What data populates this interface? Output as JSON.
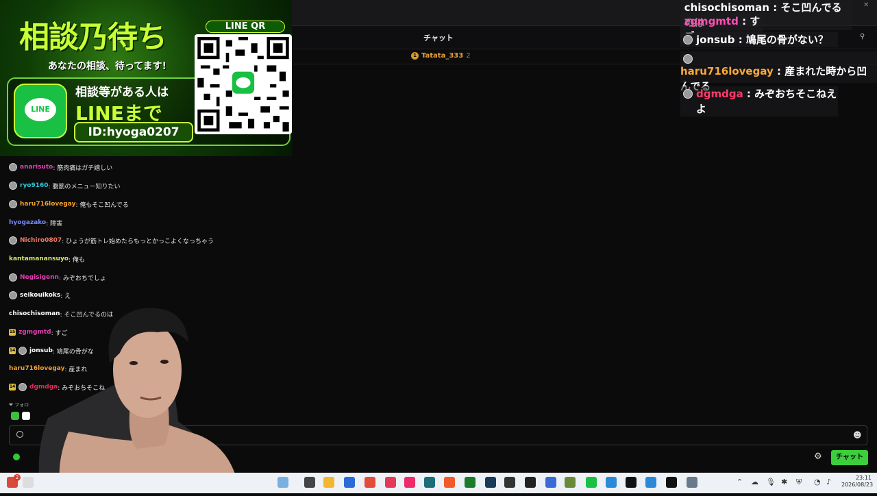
{
  "chat": {
    "title": "チャット",
    "ranking": {
      "rank": "1",
      "name": "Tatata_333",
      "count": "2"
    },
    "messages": [
      {
        "user": "anarisuto",
        "text": ": 筋肉痛はガチ嬉しい",
        "color": "#e040b0",
        "avatar": true,
        "badge": ""
      },
      {
        "user": "ryo9160",
        "text": ": 腹筋のメニュー知りたい",
        "color": "#2fc8d8",
        "avatar": true,
        "badge": ""
      },
      {
        "user": "haru716lovegay",
        "text": ": 俺もそこ凹んでる",
        "color": "#f0a030",
        "avatar": true,
        "badge": ""
      },
      {
        "user": "hyogazako",
        "text": ": 障害",
        "color": "#7a8cff",
        "avatar": false,
        "badge": ""
      },
      {
        "user": "Nichiro0807",
        "text": ": ひょうが筋トレ始めたらもっとかっこよくなっちゃう",
        "color": "#f07860",
        "avatar": true,
        "badge": ""
      },
      {
        "user": "kantamanansuyo",
        "text": ": 俺も",
        "color": "#d8e86a",
        "avatar": false,
        "badge": ""
      },
      {
        "user": "Negisigenn",
        "text": ": みぞおちでしょ",
        "color": "#e040b0",
        "avatar": true,
        "badge": ""
      },
      {
        "user": "seikouikoks",
        "text": ": え",
        "color": "#ffffff",
        "avatar": true,
        "badge": ""
      },
      {
        "user": "chisochisoman",
        "text": ": そこ凹んでるのは",
        "color": "#ffffff",
        "avatar": false,
        "badge": ""
      },
      {
        "user": "zgmgmtd",
        "text": ": すご",
        "color": "#e040b0",
        "avatar": false,
        "badge": "15"
      },
      {
        "user": "jonsub",
        "text": ": 鳩尾の骨がな",
        "color": "#ffffff",
        "avatar": true,
        "badge": "14"
      },
      {
        "user": "haru716lovegay",
        "text": ": 産まれ",
        "color": "#f0a030",
        "avatar": false,
        "badge": ""
      },
      {
        "user": "dgmdga",
        "text": ": みぞおちそこね",
        "color": "#e8285a",
        "avatar": true,
        "badge": "14"
      }
    ],
    "followers_label": "❤ フォロ",
    "send_label": "チャット"
  },
  "banner": {
    "title": "相談乃待ち",
    "subtitle": "あなたの相談、待ってます!",
    "line_logo": "LINE",
    "line1": "相談等がある人は",
    "line2": "LINEまで",
    "id": "ID:hyoga0207",
    "qr_label": "LINE QR"
  },
  "overlay": {
    "rows": [
      {
        "user": "chisochisoman",
        "text": " : そこ凹んでるのは",
        "color": "#ffffff",
        "avatar": false
      },
      {
        "user": "zgmgmtd",
        "text": " : すご",
        "color": "#ff4fb0",
        "avatar": false
      },
      {
        "user": "jonsub",
        "text": " : 鳩尾の骨がない？",
        "color": "#ffffff",
        "avatar": true
      },
      {
        "user": "haru716lovegay",
        "text": " : 産まれた時から凹んでる",
        "color": "#ffa838",
        "avatar": true
      },
      {
        "user": "dgmdga",
        "text": " : みぞおちそこねえよ",
        "color": "#ff3a68",
        "avatar": true
      }
    ]
  },
  "taskbar": {
    "time": "23:11",
    "date": "2026/08/23",
    "notification_count": "2"
  },
  "colors": {
    "accent": "#3ccf3c",
    "background": "#0b0b0c"
  }
}
